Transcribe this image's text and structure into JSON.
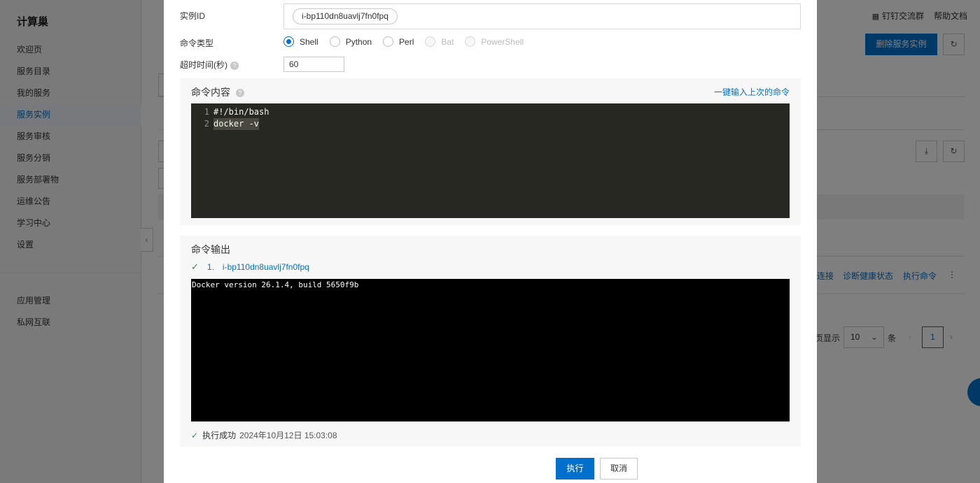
{
  "sidebar": {
    "brand": "计算巢",
    "items": [
      {
        "label": "欢迎页"
      },
      {
        "label": "服务目录"
      },
      {
        "label": "我的服务"
      },
      {
        "label": "服务实例"
      },
      {
        "label": "服务审核"
      },
      {
        "label": "服务分销"
      },
      {
        "label": "服务部署物"
      },
      {
        "label": "运维公告"
      },
      {
        "label": "学习中心"
      },
      {
        "label": "设置"
      }
    ],
    "items2": [
      {
        "label": "应用管理"
      },
      {
        "label": "私网互联"
      }
    ],
    "active_item": "服务实例"
  },
  "topbar": {
    "dingtalk_label": "钉钉交流群",
    "help_label": "帮助文档"
  },
  "background": {
    "delete_button": "删除服务实例",
    "actions": [
      "连接",
      "诊断健康状态",
      "执行命令"
    ],
    "pager_prefix": "页显示",
    "page_size": "10",
    "pager_suffix": "条",
    "current_page": "1"
  },
  "dialog": {
    "instance_id_label": "实例ID",
    "instance_id_tag": "i-bp110dn8uavlj7fn0fpq",
    "command_type_label": "命令类型",
    "command_types": [
      {
        "label": "Shell",
        "state": "checked"
      },
      {
        "label": "Python",
        "state": "normal"
      },
      {
        "label": "Perl",
        "state": "normal"
      },
      {
        "label": "Bat",
        "state": "disabled"
      },
      {
        "label": "PowerShell",
        "state": "disabled"
      }
    ],
    "timeout_label": "超时时间(秒)",
    "timeout_value": "60",
    "content_title": "命令内容",
    "load_last_link": "一键输入上次的命令",
    "code_lines": [
      {
        "no": "1",
        "text": "#!/bin/bash"
      },
      {
        "no": "2",
        "text": "docker -v"
      }
    ],
    "output_title": "命令输出",
    "output_index": "1.",
    "output_instance": "i-bp110dn8uavlj7fn0fpq",
    "output_text": "Docker version 26.1.4, build 5650f9b",
    "status_text": "执行成功",
    "status_time": "2024年10月12日 15:03:08",
    "execute_button": "执行",
    "cancel_button": "取消"
  }
}
